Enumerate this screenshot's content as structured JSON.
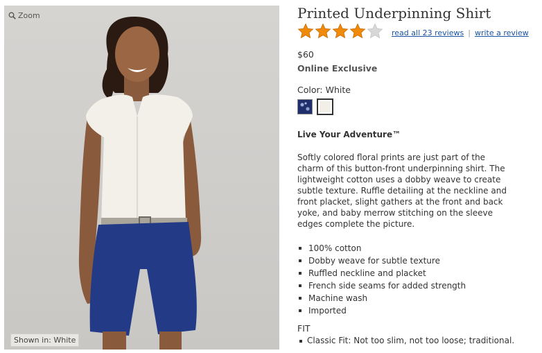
{
  "photo": {
    "zoom_label": "Zoom",
    "shown_in": "Shown in: White"
  },
  "product": {
    "title": "Printed Underpinning Shirt",
    "rating": 4,
    "rating_max": 5,
    "read_reviews": "read all 23 reviews",
    "separator": "|",
    "write_review": "write a review",
    "price": "$60",
    "exclusive": "Online Exclusive",
    "color_label": "Color:",
    "color_value": "White",
    "swatches": [
      {
        "name": "Navy print"
      },
      {
        "name": "White"
      }
    ],
    "tagline": "Live Your Adventure™",
    "description": "Softly colored floral prints are just part of the charm of this button-front underpinning shirt. The lightweight cotton uses a dobby weave to create subtle texture. Ruffle detailing at the neckline and front placket, slight gathers at the front and back yoke, and baby merrow stitching on the sleeve edges complete the picture.",
    "features": [
      "100% cotton",
      "Dobby weave for subtle texture",
      "Ruffled neckline and placket",
      "French side seams for added strength",
      "Machine wash",
      "Imported"
    ],
    "fit_heading": "FIT",
    "fit_items": [
      "Classic Fit: Not too slim, not too loose; traditional."
    ]
  },
  "colors": {
    "link": "#1a53a3",
    "star_on": "#f08a0a",
    "star_off": "#d8d8d8"
  }
}
